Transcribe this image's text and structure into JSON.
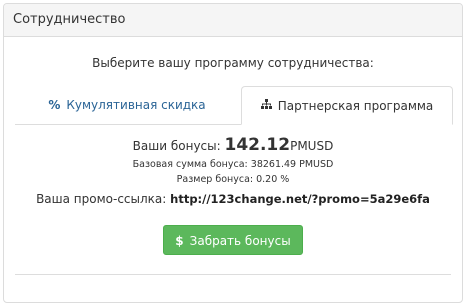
{
  "panel": {
    "title": "Сотрудничество"
  },
  "prompt": "Выберите вашу программу сотрудничества:",
  "tabs": [
    {
      "icon": "%",
      "icon_name": "percent-icon",
      "label": "Кумулятивная скидка",
      "active": false
    },
    {
      "icon_name": "sitemap-icon",
      "label": "Партнерская программа",
      "active": true
    }
  ],
  "partner": {
    "bonus_label": "Ваши бонусы:",
    "bonus_value": "142.12",
    "bonus_currency": "PMUSD",
    "base_sum_text": "Базовая сумма бонуса: 38261.49 PMUSD",
    "bonus_size_text": "Размер бонуса: 0.20 %",
    "promo_label": "Ваша промо-ссылка:",
    "promo_link": "http://123change.net/?promo=5a29e6fa",
    "withdraw_icon": "$",
    "withdraw_label": "Забрать бонусы"
  },
  "colors": {
    "link": "#2a6496",
    "success": "#5cb85c",
    "heading_bg": "#f5f5f5",
    "border": "#dcdcdc"
  }
}
